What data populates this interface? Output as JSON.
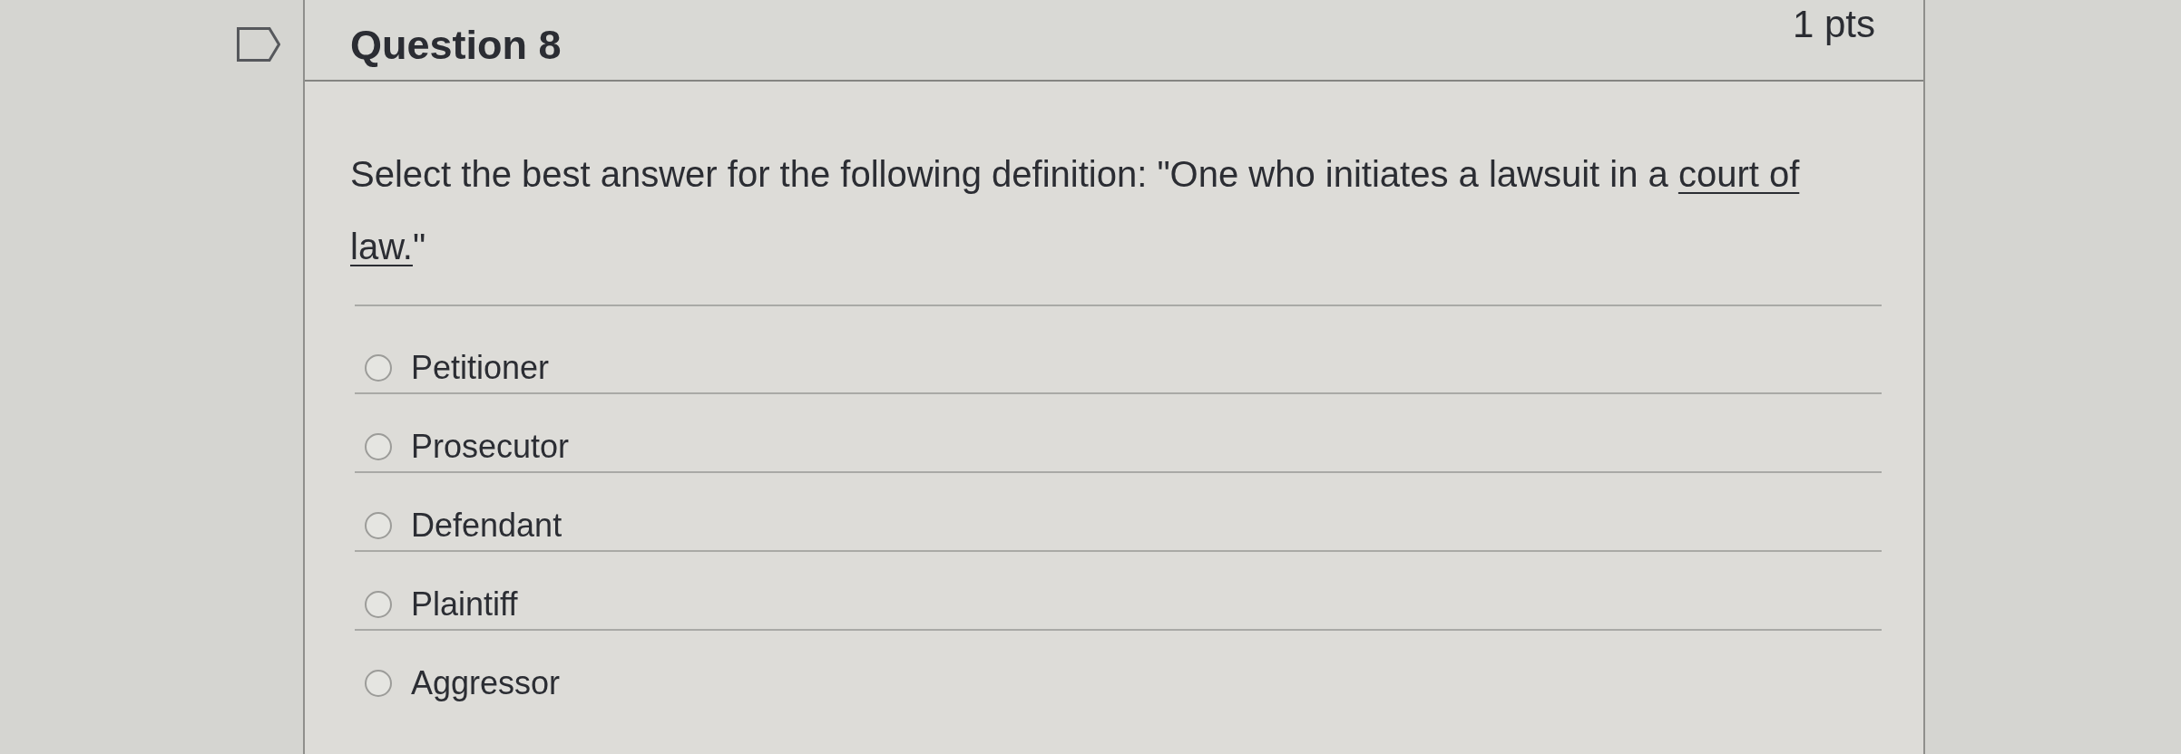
{
  "question": {
    "title": "Question 8",
    "points": "1 pts",
    "prompt": [
      {
        "text": "Select the best answer for the following definition: \"One who initiates a lawsuit in a ",
        "underlined": false
      },
      {
        "text": "court of law.",
        "underlined": true
      },
      {
        "text": "\"",
        "underlined": false
      }
    ],
    "options": [
      {
        "label": "Petitioner",
        "selected": false
      },
      {
        "label": "Prosecutor",
        "selected": false
      },
      {
        "label": "Defendant",
        "selected": false
      },
      {
        "label": "Plaintiff",
        "selected": false
      },
      {
        "label": "Aggressor",
        "selected": false
      }
    ]
  }
}
